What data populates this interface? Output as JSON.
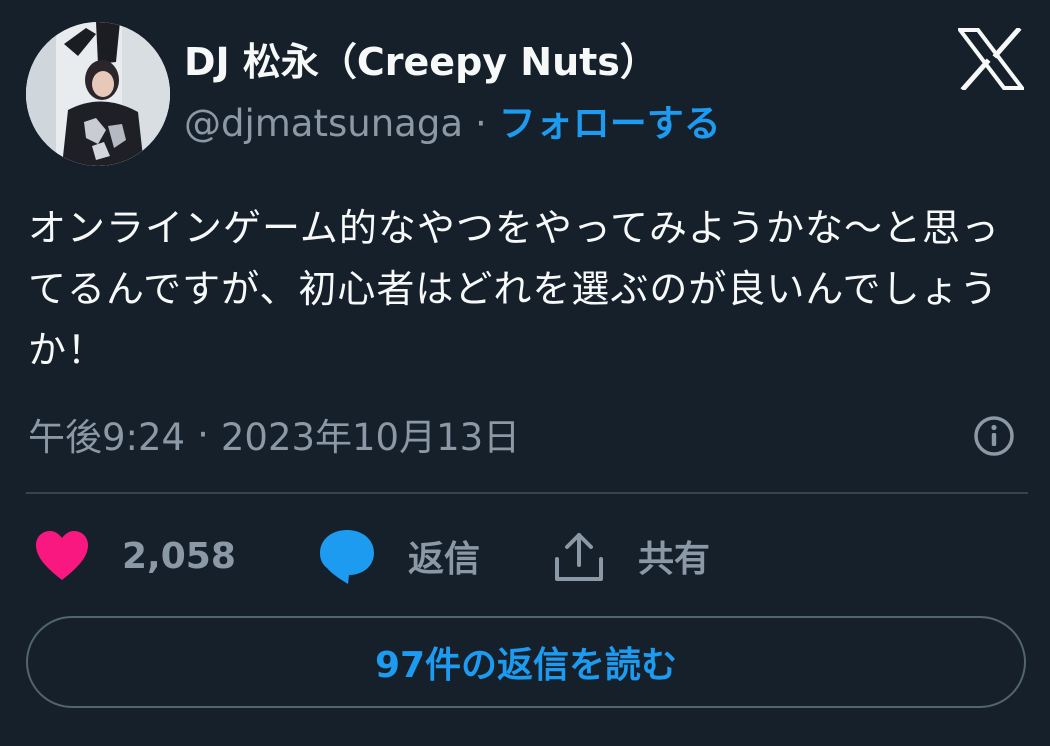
{
  "author": {
    "display_name": "DJ 松永（Creepy Nuts）",
    "handle": "@djmatsunaga",
    "separator": "·",
    "follow_label": "フォローする"
  },
  "tweet": {
    "text": "オンラインゲーム的なやつをやってみようかな〜と思ってるんですが、初心者はどれを選ぶのが良いんでしょうか！",
    "time": "午後9:24",
    "meta_separator": "·",
    "date": "2023年10月13日"
  },
  "actions": {
    "like_count": "2,058",
    "reply_label": "返信",
    "share_label": "共有"
  },
  "read_replies_label": "97件の返信を読む",
  "icons": {
    "logo": "x-logo-icon",
    "info": "info-icon",
    "like": "heart-icon",
    "reply": "speech-bubble-icon",
    "share": "share-upload-icon"
  },
  "colors": {
    "background": "#15202b",
    "text_primary": "#f7f9f9",
    "text_secondary": "#8b98a5",
    "accent_blue": "#1d9bf0",
    "heart_pink": "#f91880",
    "divider": "#38444d"
  }
}
